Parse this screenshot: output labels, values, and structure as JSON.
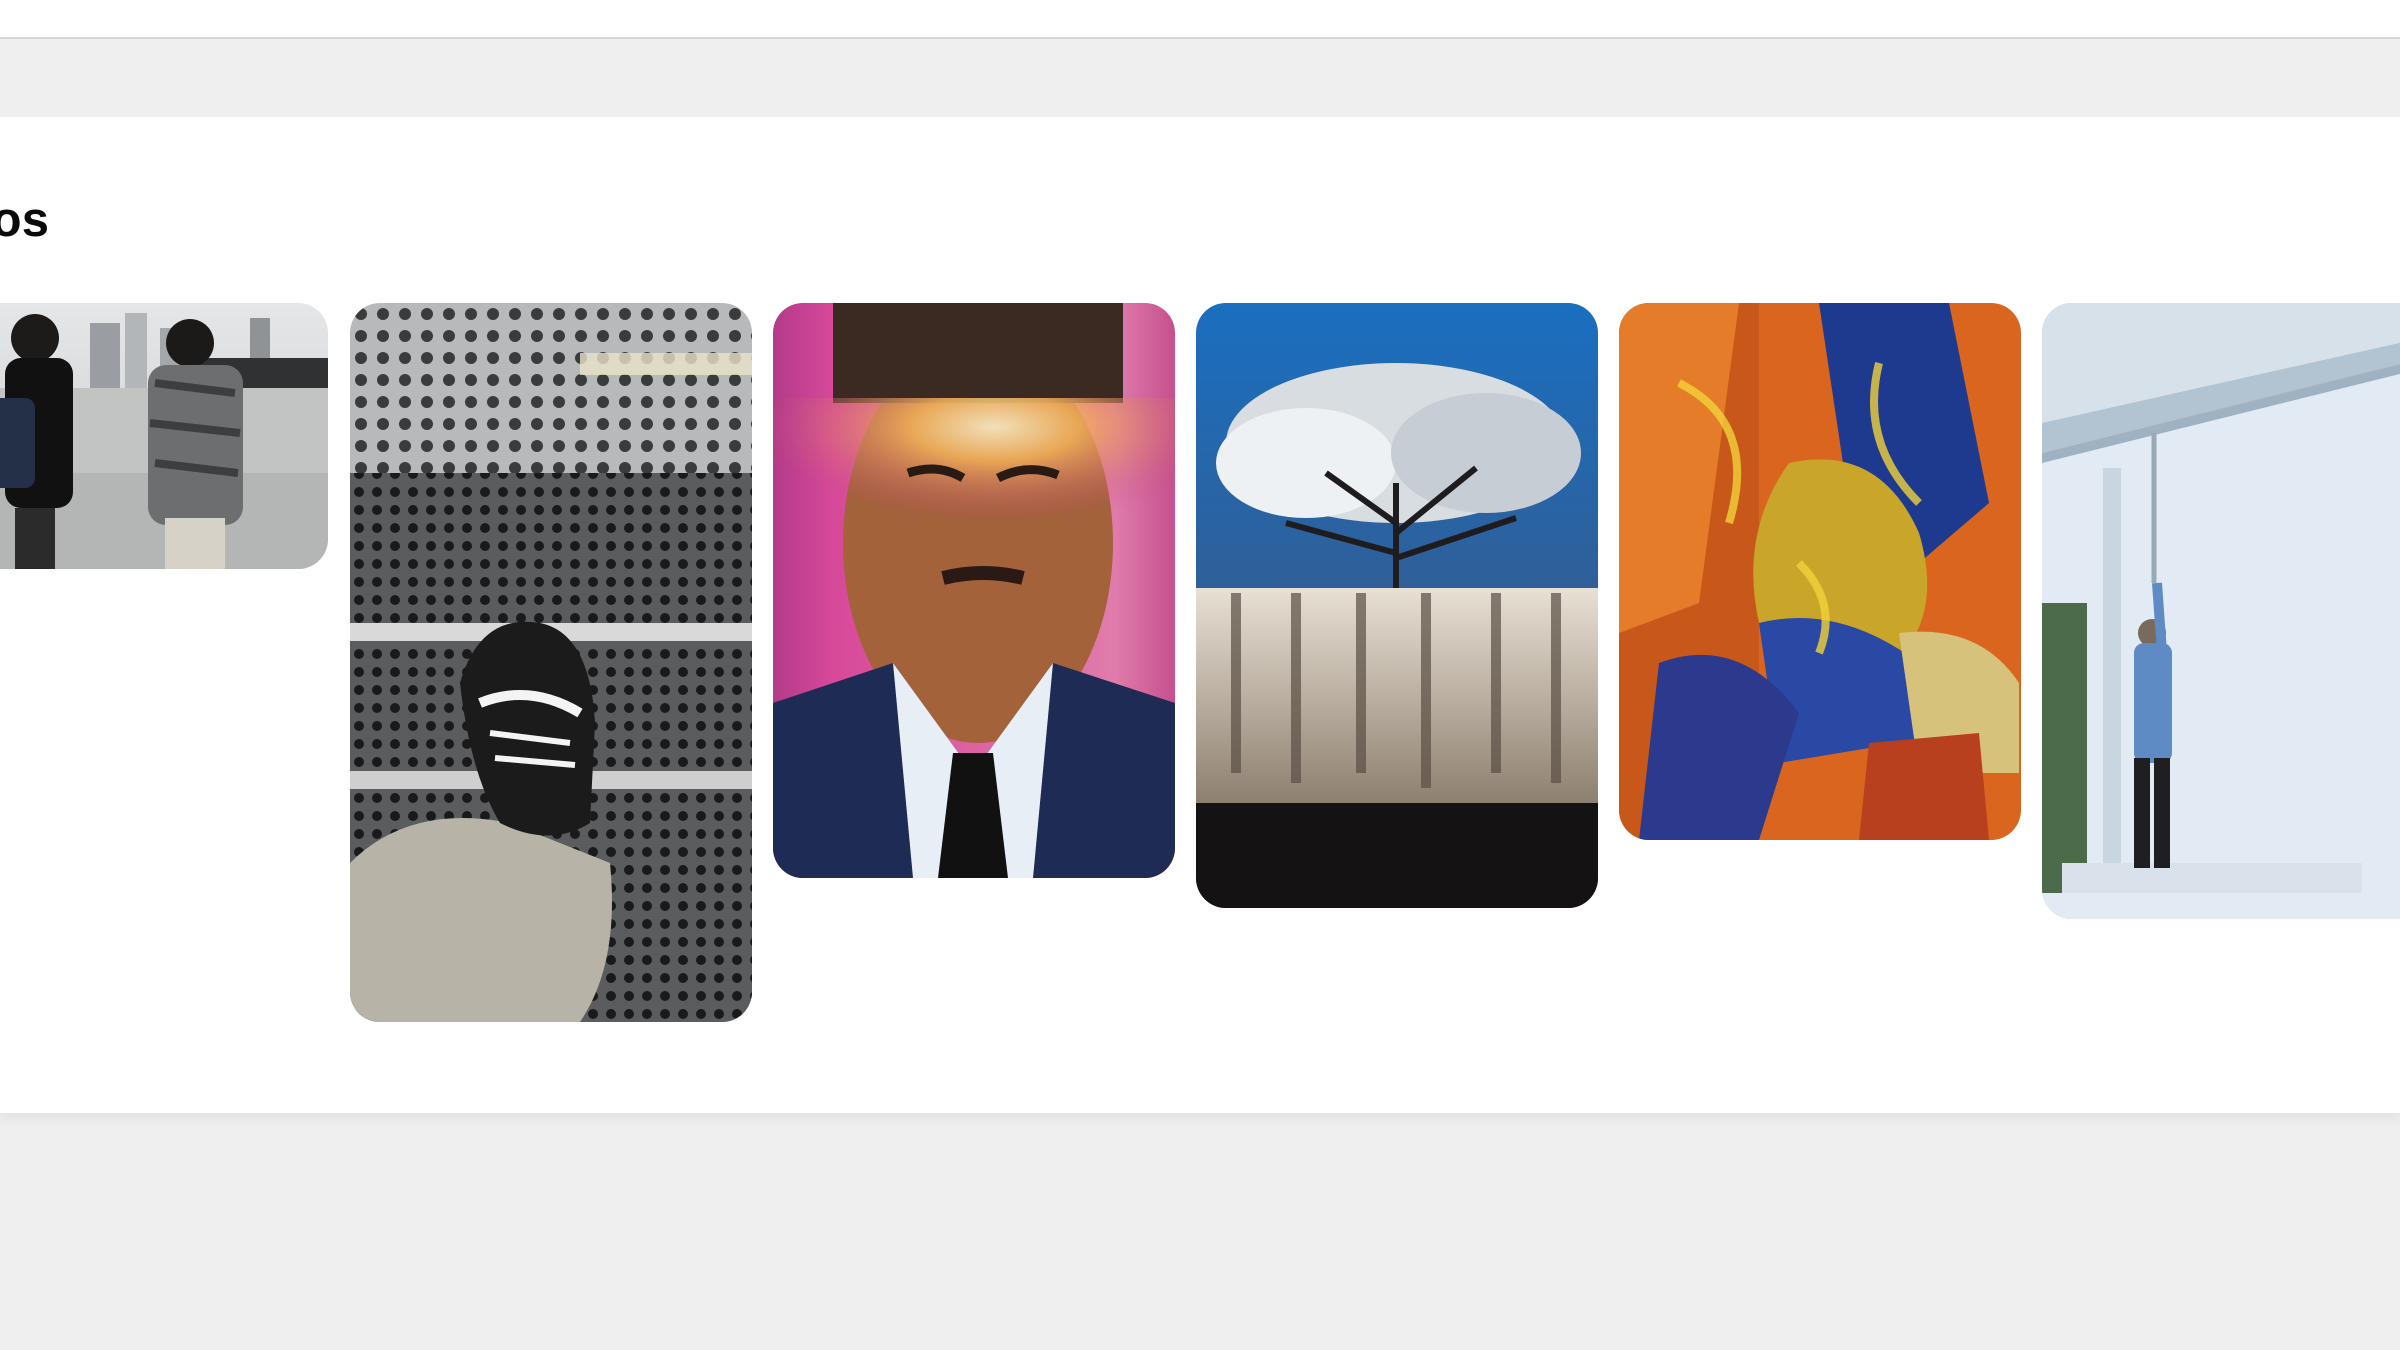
{
  "section": {
    "title": "otos"
  },
  "photos": [
    {
      "icon": "photo-two-men-city-plaza"
    },
    {
      "icon": "photo-sneaker-perforated-steps"
    },
    {
      "icon": "photo-man-portrait-light-leak"
    },
    {
      "icon": "photo-blossom-tree-and-curtains"
    },
    {
      "icon": "photo-abstract-painting"
    },
    {
      "icon": "photo-man-painting-wall"
    }
  ],
  "colors": {
    "page_background": "#efefef",
    "panel_background": "#ffffff",
    "title_text": "#0a0a0a"
  }
}
